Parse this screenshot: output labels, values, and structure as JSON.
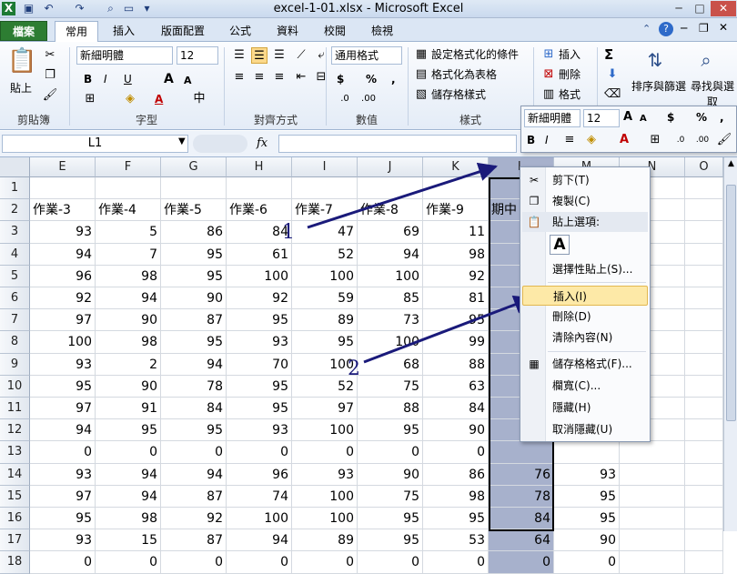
{
  "window": {
    "title": "excel-1-01.xlsx  -  Microsoft Excel",
    "minimize": "─",
    "maximize": "□",
    "close": "✕"
  },
  "qat": {
    "app_icon": "excel-app-icon",
    "save": "save-icon",
    "undo": "undo-icon",
    "redo": "redo-icon",
    "print_preview": "print-preview-icon",
    "new": "new-document-icon",
    "customize": "customize-qat-icon"
  },
  "tabs": [
    "檔案",
    "常用",
    "插入",
    "版面配置",
    "公式",
    "資料",
    "校閱",
    "檢視"
  ],
  "ribbon": {
    "clipboard": {
      "paste": "貼上",
      "label": "剪貼簿"
    },
    "font": {
      "name": "新細明體",
      "size": "12",
      "bold": "B",
      "italic": "I",
      "underline": "U",
      "grow": "A",
      "shrink": "A",
      "color_letter": "A",
      "label": "字型"
    },
    "alignment": {
      "label": "對齊方式"
    },
    "number": {
      "format": "通用格式",
      "currency": "$",
      "percent": "%",
      "comma": ",",
      "label": "數值"
    },
    "styles": {
      "conditional": "設定格式化的條件",
      "as_table": "格式化為表格",
      "cell_styles": "儲存格樣式",
      "label": "樣式"
    },
    "cells": {
      "insert": "插入",
      "delete": "刪除",
      "format": "格式"
    },
    "editing": {
      "sum": "Σ",
      "sort": "排序與篩選",
      "find": "尋找與選取"
    }
  },
  "formula_bar": {
    "name_box": "L1",
    "fx": "fx",
    "content": ""
  },
  "grid": {
    "columns": [
      "E",
      "F",
      "G",
      "H",
      "I",
      "J",
      "K",
      "L",
      "M",
      "N",
      "O"
    ],
    "row_numbers": [
      "1",
      "2",
      "3",
      "4",
      "5",
      "6",
      "7",
      "8",
      "9",
      "10",
      "11",
      "12",
      "13",
      "14",
      "15",
      "16",
      "17",
      "18"
    ],
    "row2": [
      "作業-3",
      "作業-4",
      "作業-5",
      "作業-6",
      "作業-7",
      "作業-8",
      "作業-9",
      "期中"
    ],
    "data": [
      [
        "93",
        "5",
        "86",
        "84",
        "47",
        "69",
        "11"
      ],
      [
        "94",
        "7",
        "95",
        "61",
        "52",
        "94",
        "98"
      ],
      [
        "96",
        "98",
        "95",
        "100",
        "100",
        "100",
        "92"
      ],
      [
        "92",
        "94",
        "90",
        "92",
        "59",
        "85",
        "81"
      ],
      [
        "97",
        "90",
        "87",
        "95",
        "89",
        "73",
        "95"
      ],
      [
        "100",
        "98",
        "95",
        "93",
        "95",
        "100",
        "99"
      ],
      [
        "93",
        "2",
        "94",
        "70",
        "100",
        "68",
        "88"
      ],
      [
        "95",
        "90",
        "78",
        "95",
        "52",
        "75",
        "63"
      ],
      [
        "97",
        "91",
        "84",
        "95",
        "97",
        "88",
        "84"
      ],
      [
        "94",
        "95",
        "95",
        "93",
        "100",
        "95",
        "90"
      ],
      [
        "0",
        "0",
        "0",
        "0",
        "0",
        "0",
        "0"
      ],
      [
        "93",
        "94",
        "94",
        "96",
        "93",
        "90",
        "86"
      ],
      [
        "97",
        "94",
        "87",
        "74",
        "100",
        "75",
        "98"
      ],
      [
        "95",
        "98",
        "92",
        "100",
        "100",
        "95",
        "95"
      ],
      [
        "93",
        "15",
        "87",
        "94",
        "89",
        "95",
        "53"
      ],
      [
        "0",
        "0",
        "0",
        "0",
        "0",
        "0",
        "0"
      ]
    ],
    "col_l_visible": {
      "14": "76",
      "15": "78",
      "16": "84",
      "17": "64",
      "18": "0"
    },
    "col_m_visible": {
      "14": "93",
      "15": "95",
      "16": "95",
      "17": "90",
      "18": "0"
    }
  },
  "annotations": {
    "one": "1",
    "two": "2",
    "arrow_color": "#1a1a7a"
  },
  "mini_toolbar": {
    "font": "新細明體",
    "size": "12",
    "grow": "A",
    "shrink": "A",
    "currency": "$",
    "percent": "%",
    "comma": ",",
    "bold": "B",
    "italic": "I"
  },
  "context_menu": {
    "cut": "剪下(T)",
    "copy": "複製(C)",
    "paste_options": "貼上選項:",
    "paste_special": "選擇性貼上(S)...",
    "insert": "插入(I)",
    "delete": "刪除(D)",
    "clear": "清除內容(N)",
    "format_cells": "儲存格格式(F)...",
    "column_width": "欄寬(C)...",
    "hide": "隱藏(H)",
    "unhide": "取消隱藏(U)",
    "paste_icon_letter": "A"
  },
  "colors": {
    "accent": "#2d7d32",
    "selected_column": "#a7b1cc",
    "menu_highlight": "#fde9a7"
  }
}
